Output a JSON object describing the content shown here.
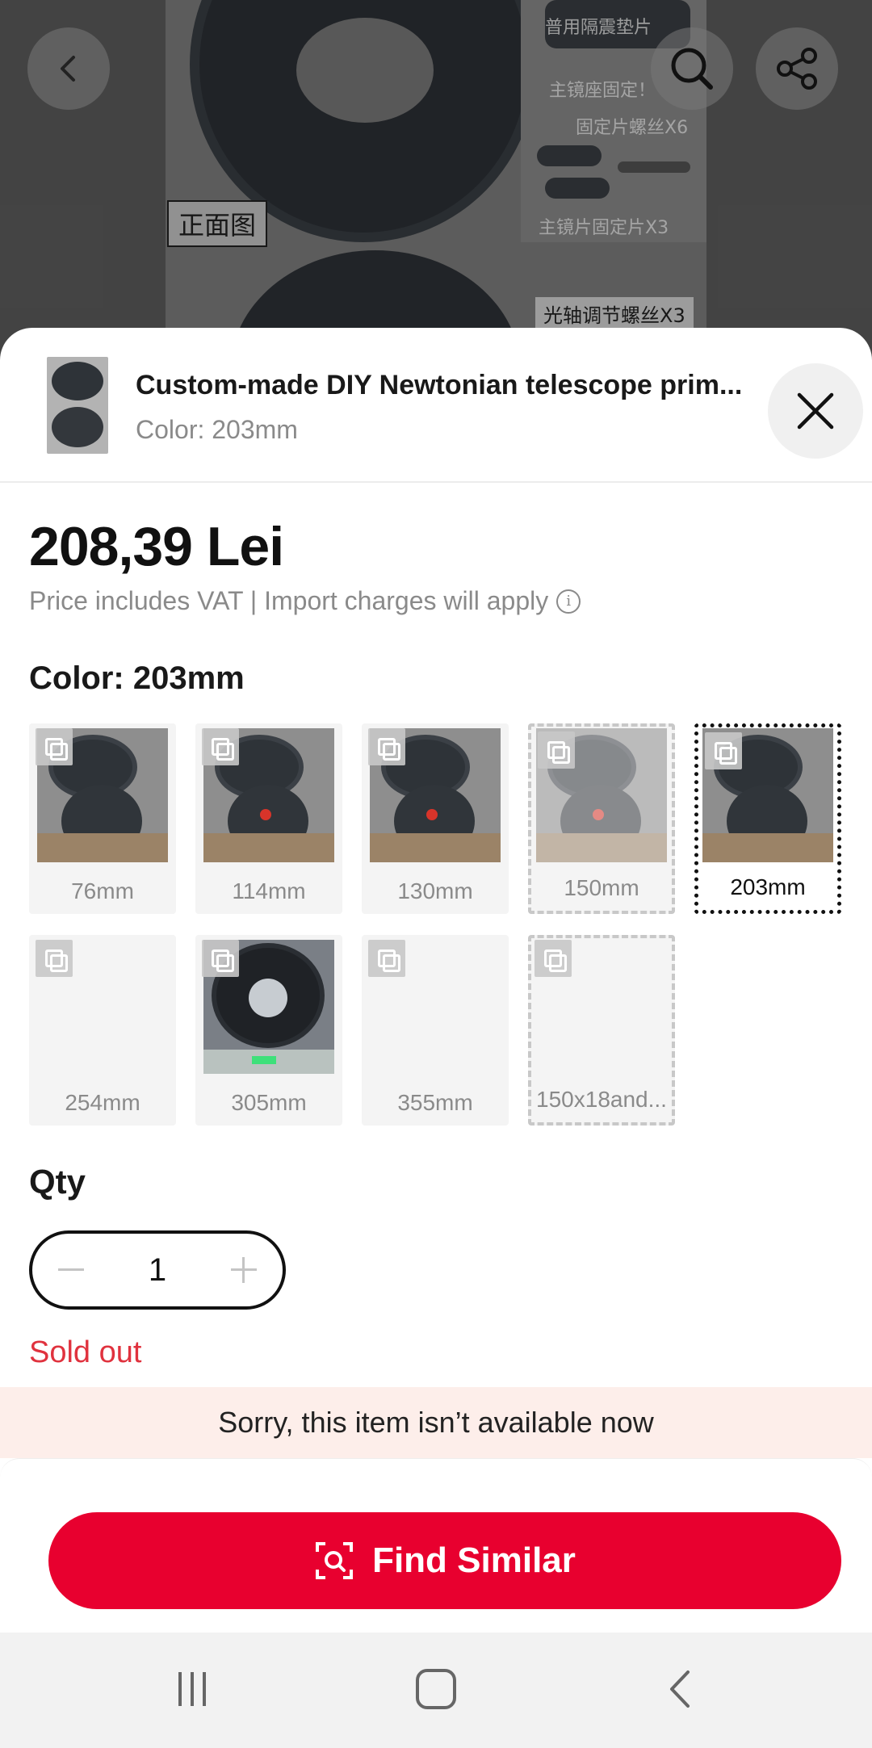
{
  "background": {
    "image_labels": {
      "top_right_1": "普用隔震垫片",
      "top_right_2": "主镜座固定！",
      "top_right_3": "固定片螺丝X6",
      "mid_right": "主镜片固定片X3",
      "front_view": "正面图",
      "bottom_right": "光轴调节螺丝X3"
    }
  },
  "toolbar": {
    "back_icon": "chevron-left-icon",
    "search_icon": "search-icon",
    "share_icon": "share-icon"
  },
  "header": {
    "title": "Custom-made DIY Newtonian telescope prim...",
    "subtitle": "Color: 203mm",
    "close_icon": "close-icon"
  },
  "price": {
    "amount": "208,39 Lei",
    "note": "Price includes VAT | Import charges will apply"
  },
  "color_section": {
    "label": "Color: 203mm",
    "options": [
      {
        "label": "76mm",
        "state": "normal",
        "has_image": true
      },
      {
        "label": "114mm",
        "state": "normal",
        "has_image": true
      },
      {
        "label": "130mm",
        "state": "normal",
        "has_image": true
      },
      {
        "label": "150mm",
        "state": "unavailable",
        "has_image": true
      },
      {
        "label": "203mm",
        "state": "selected",
        "has_image": true
      },
      {
        "label": "254mm",
        "state": "normal",
        "has_image": false
      },
      {
        "label": "305mm",
        "state": "normal",
        "has_image": true
      },
      {
        "label": "355mm",
        "state": "normal",
        "has_image": false
      },
      {
        "label": "150x18and...",
        "state": "unavailable",
        "has_image": false
      }
    ]
  },
  "quantity": {
    "label": "Qty",
    "value": "1"
  },
  "status": {
    "sold_out": "Sold out",
    "notice": "Sorry, this item isn’t available now"
  },
  "actions": {
    "find_similar": "Find Similar"
  },
  "colors": {
    "accent_red": "#e8002f",
    "sold_out_red": "#e0323e",
    "notice_bg": "#fdeeea"
  }
}
